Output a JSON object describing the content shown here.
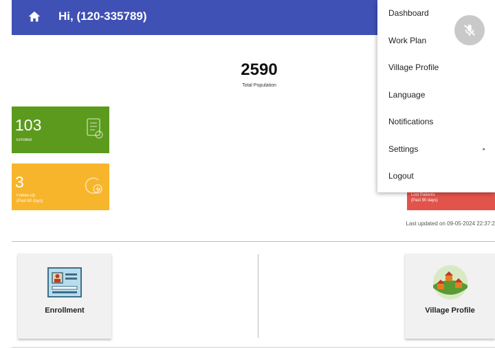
{
  "header": {
    "title": "Hi, (120-335789)"
  },
  "population": {
    "value": "2590",
    "label": "Total Population"
  },
  "tiles": [
    {
      "value": "103",
      "label": "Enrolled",
      "color": "#5c9a1e"
    },
    {
      "value": "3",
      "label_line1": "Follow-Up",
      "label_line2": "(Past 60 days)",
      "color": "#f7b52c"
    }
  ],
  "red_tile": {
    "label_line1": "Lost Patients",
    "label_line2": "(Past 90 days)",
    "color": "#e2534b"
  },
  "last_updated": "Last updated on 09-05-2024 22:37:2",
  "cards": {
    "enrollment": "Enrollment",
    "village_profile": "Village Profile"
  },
  "menu": {
    "items": [
      "Dashboard",
      "Work Plan",
      "Village Profile",
      "Language",
      "Notifications",
      "Settings",
      "Logout"
    ],
    "submenu_arrow": "▸"
  },
  "icons": [
    "home-icon",
    "checklist-icon",
    "clock-add-icon",
    "mic-off-icon",
    "id-card-icon",
    "village-icon"
  ],
  "colors": {
    "header": "#3f51b5"
  }
}
